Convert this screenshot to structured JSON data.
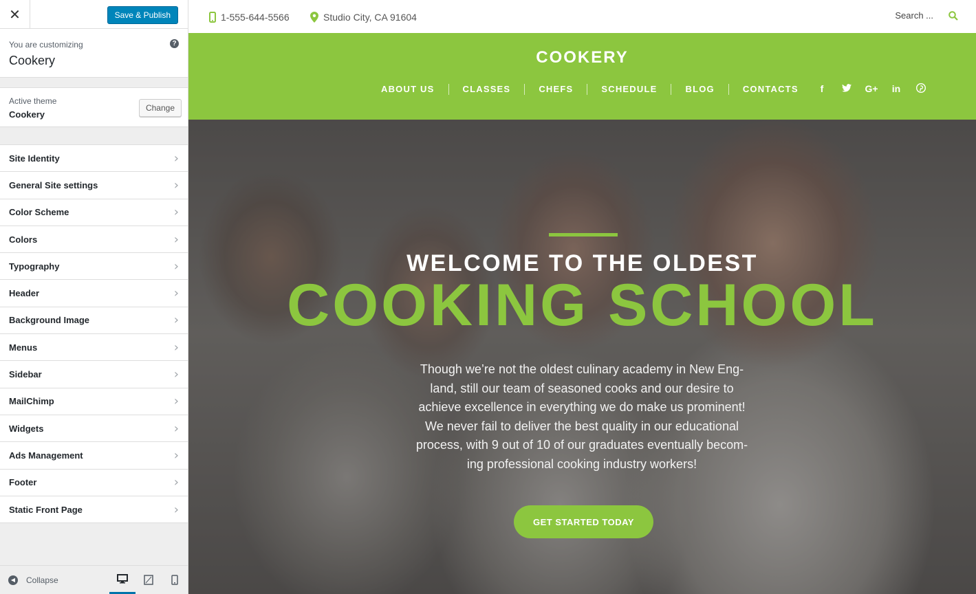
{
  "customizer": {
    "close_label": "✕",
    "save_label": "Save & Publish",
    "customizing_label": "You are customizing",
    "site_name": "Cookery",
    "help_glyph": "?",
    "active_theme_label": "Active theme",
    "theme_name": "Cookery",
    "change_label": "Change",
    "panels": [
      {
        "label": "Site Identity"
      },
      {
        "label": "General Site settings"
      },
      {
        "label": "Color Scheme"
      },
      {
        "label": "Colors"
      },
      {
        "label": "Typography"
      },
      {
        "label": "Header"
      },
      {
        "label": "Background Image"
      },
      {
        "label": "Menus"
      },
      {
        "label": "Sidebar"
      },
      {
        "label": "MailChimp"
      },
      {
        "label": "Widgets"
      },
      {
        "label": "Ads Management"
      },
      {
        "label": "Footer"
      },
      {
        "label": "Static Front Page"
      }
    ],
    "chevron_glyph": "›",
    "collapse_label": "Collapse",
    "collapse_icon": "arrow-left-circle-icon",
    "devices": [
      "desktop-icon",
      "tablet-icon",
      "mobile-icon"
    ],
    "accent_color": "#0085ba"
  },
  "site": {
    "phone": "1-555-644-5566",
    "address": "Studio City, CA 91604",
    "search_placeholder": "Search ...",
    "logo": "COOKERY",
    "menu": [
      {
        "label": "ABOUT US"
      },
      {
        "label": "CLASSES"
      },
      {
        "label": "CHEFS"
      },
      {
        "label": "SCHEDULE"
      },
      {
        "label": "BLOG"
      },
      {
        "label": "CONTACTS"
      }
    ],
    "social": [
      {
        "icon": "facebook-icon",
        "glyph": "f"
      },
      {
        "icon": "twitter-icon",
        "glyph": "🐦"
      },
      {
        "icon": "google-plus-icon",
        "glyph": "G+"
      },
      {
        "icon": "linkedin-icon",
        "glyph": "in"
      },
      {
        "icon": "pinterest-icon",
        "glyph": "℗"
      }
    ],
    "hero": {
      "title_line1": "WELCOME TO THE OLDEST",
      "title_line2": "COOKING SCHOOL",
      "body": "Though we’re not the oldest culinary academy in New Eng-land, still our team of seasoned cooks and our desire to achieve excellence in everything we do make us prominent! We never fail to deliver the best quality in our educational process, with 9 out of 10 of our graduates eventually becom-ing professional cooking industry workers!",
      "cta": "GET STARTED TODAY"
    },
    "brand_color": "#8cc63f"
  }
}
